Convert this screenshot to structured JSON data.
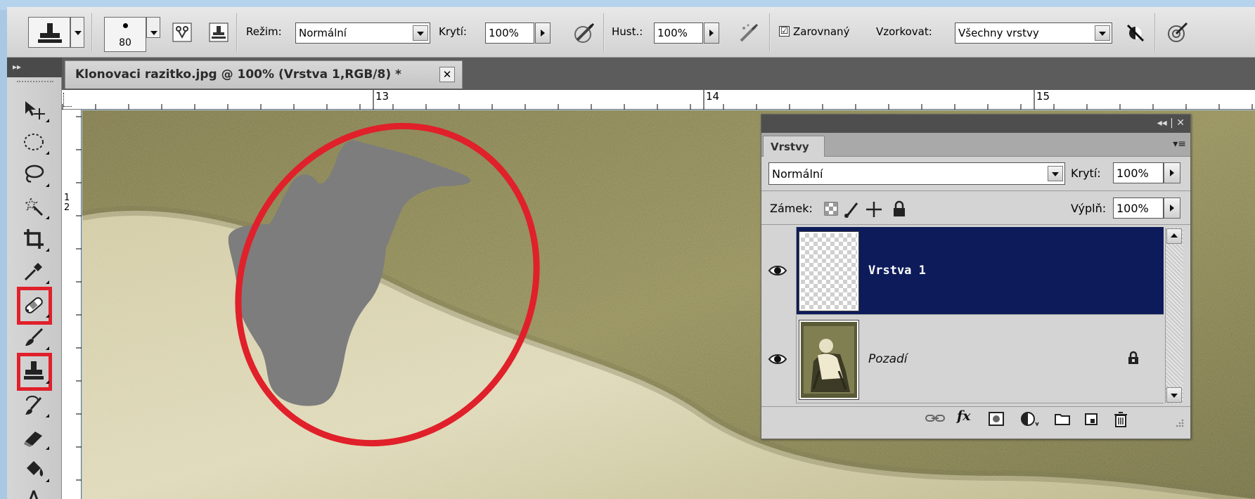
{
  "options_bar": {
    "brush_size": "80",
    "mode_label": "Režim:",
    "mode_value": "Normální",
    "opacity_label": "Krytí:",
    "opacity_value": "100%",
    "flow_label": "Hust.:",
    "flow_value": "100%",
    "aligned_check": "☑",
    "aligned_label": "Zarovnaný",
    "sample_label": "Vzorkovat:",
    "sample_value": "Všechny vrstvy"
  },
  "document_tab": {
    "title": "Klonovaci razitko.jpg @ 100% (Vrstva 1,RGB/8) *",
    "close": "✕"
  },
  "toolbox": {
    "collapse": "▸▸",
    "tools": [
      "move-tool",
      "marquee-tool",
      "lasso-tool",
      "magic-wand-tool",
      "crop-tool",
      "eyedropper-tool",
      "healing-brush-tool",
      "brush-tool",
      "clone-stamp-tool",
      "history-brush-tool",
      "eraser-tool",
      "paint-bucket-tool"
    ],
    "highlighted": [
      "healing-brush-tool",
      "clone-stamp-tool"
    ],
    "highlight_color": "#e0202a"
  },
  "rulers": {
    "top": [
      "13",
      "14",
      "15"
    ],
    "left": [
      "1",
      "2"
    ]
  },
  "layers_panel": {
    "panel_controls": "◂◂ | ✕",
    "tab": "Vrstvy",
    "menu_icon": "▾≡",
    "blend_mode": "Normální",
    "opacity_label": "Krytí:",
    "opacity_value": "100%",
    "lock_label": "Zámek:",
    "fill_label": "Výplň:",
    "fill_value": "100%",
    "layers": [
      {
        "name": "Vrstva 1",
        "active": true,
        "visible": true
      },
      {
        "name": "Pozadí",
        "active": false,
        "visible": true,
        "locked": true
      }
    ],
    "bottom_icons": [
      "link-icon",
      "fx-icon",
      "mask-icon",
      "adjustment-icon",
      "folder-icon",
      "new-layer-icon",
      "trash-icon"
    ],
    "fx_label": "fx"
  },
  "colors": {
    "selection": "#0d1b5a",
    "annotation": "#e0202a",
    "clone_patch": "#7d7d7d"
  }
}
